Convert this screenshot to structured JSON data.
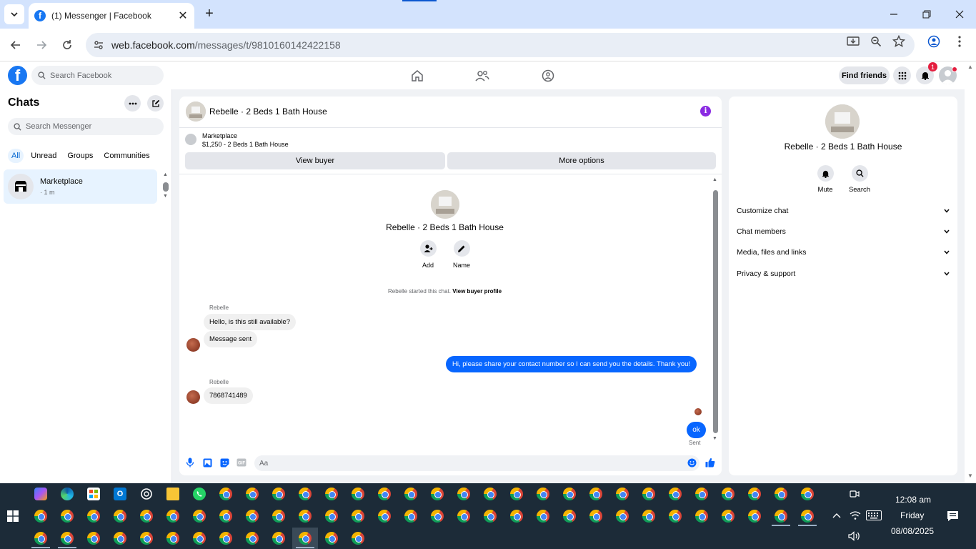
{
  "browser": {
    "tab_title": "(1) Messenger | Facebook",
    "url_host": "web.facebook.com",
    "url_path": "/messages/t/9810160142422158"
  },
  "fb_header": {
    "search_placeholder": "Search Facebook",
    "find_friends": "Find friends",
    "notification_count": "1"
  },
  "sidebar": {
    "title": "Chats",
    "search_placeholder": "Search Messenger",
    "filters": [
      "All",
      "Unread",
      "Groups",
      "Communities"
    ],
    "chats": [
      {
        "name": "Marketplace",
        "time": "· 1 m"
      }
    ]
  },
  "conversation": {
    "title": "Rebelle · 2 Beds 1 Bath House",
    "marketplace_label": "Marketplace",
    "listing": "$1,250 - 2 Beds 1 Bath House",
    "view_buyer": "View buyer",
    "more_options": "More options",
    "intro_name": "Rebelle · 2 Beds 1 Bath House",
    "add_label": "Add",
    "name_label": "Name",
    "started_text": "Rebelle started this chat.",
    "started_link": "View buyer profile",
    "messages": [
      {
        "sender": "Rebelle",
        "text": "Hello, is this still available?"
      },
      {
        "text": "Message sent"
      },
      {
        "text": "Hi, please share your contact number so I can send you the details. Thank you!"
      },
      {
        "sender": "Rebelle",
        "text": "7868741489"
      },
      {
        "text": "ok",
        "status": "Sent"
      }
    ],
    "composer_placeholder": "Aa"
  },
  "right_panel": {
    "name": "Rebelle · 2 Beds 1 Bath House",
    "mute": "Mute",
    "search": "Search",
    "sections": [
      "Customize chat",
      "Chat members",
      "Media, files and links",
      "Privacy & support"
    ]
  },
  "taskbar": {
    "time": "12:08 am",
    "day": "Friday",
    "date": "08/08/2025"
  },
  "colors": {
    "fb_blue": "#1877f2",
    "messenger_blue": "#0866ff",
    "info_purple": "#8a2be2",
    "taskbar": "#1c2b38"
  }
}
